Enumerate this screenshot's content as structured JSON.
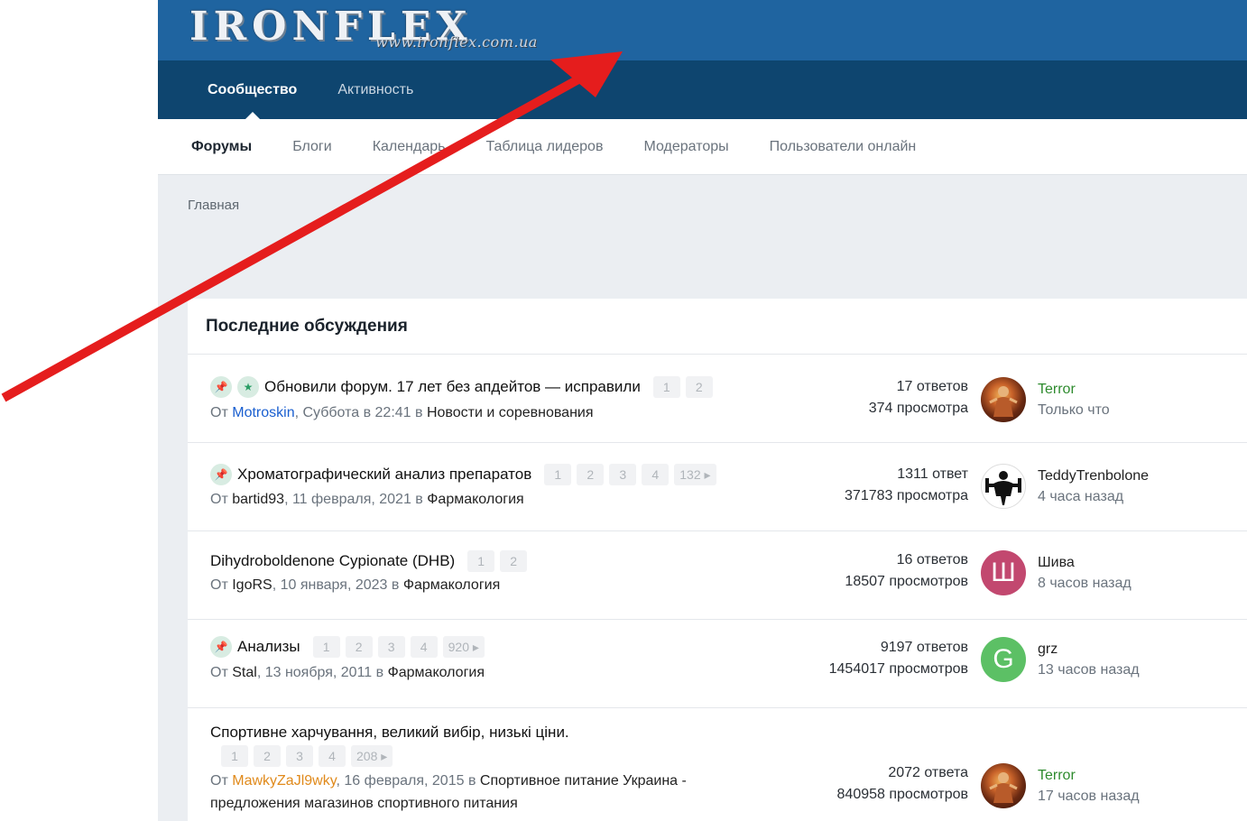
{
  "header": {
    "logo_text": "IRONFLEX",
    "logo_url": "www.ironflex.com.ua"
  },
  "primary_nav": [
    {
      "label": "Сообщество",
      "active": true
    },
    {
      "label": "Активность",
      "active": false
    }
  ],
  "secondary_nav": [
    {
      "label": "Форумы",
      "active": true
    },
    {
      "label": "Блоги",
      "active": false
    },
    {
      "label": "Календарь",
      "active": false
    },
    {
      "label": "Таблица лидеров",
      "active": false
    },
    {
      "label": "Модераторы",
      "active": false
    },
    {
      "label": "Пользователи онлайн",
      "active": false
    }
  ],
  "breadcrumb": "Главная",
  "panel_title": "Последние обсуждения",
  "topics": [
    {
      "title": "Обновили форум. 17 лет без апдейтов — исправили",
      "pinned": true,
      "featured": true,
      "pages": [
        "1",
        "2"
      ],
      "by": "От",
      "author": "Motroskin",
      "author_color": "#1a5fd0",
      "date": ", Суббота в 22:41 в ",
      "forum": "Новости и соревнования",
      "replies": "17 ответов",
      "views": "374 просмотра",
      "last_user": "Terror",
      "last_user_style": "green",
      "last_time": "Только что",
      "avatar": {
        "type": "image",
        "color": "#7a2e12",
        "letter": ""
      }
    },
    {
      "title": "Хроматографический анализ препаратов",
      "pinned": true,
      "featured": false,
      "pages": [
        "1",
        "2",
        "3",
        "4",
        "132 ▸"
      ],
      "by": "От",
      "author": "bartid93",
      "author_color": "#222222",
      "date": ", 11 февраля, 2021 в ",
      "forum": "Фармакология",
      "replies": "1311 ответ",
      "views": "371783 просмотра",
      "last_user": "TeddyTrenbolone",
      "last_user_style": "dark",
      "last_time": "4 часа назад",
      "avatar": {
        "type": "silhouette",
        "color": "#ffffff",
        "letter": ""
      }
    },
    {
      "title": "Dihydroboldenone Cypionate (DHB)",
      "pinned": false,
      "featured": false,
      "pages": [
        "1",
        "2"
      ],
      "by": "От",
      "author": "IgoRS",
      "author_color": "#222222",
      "date": ", 10 января, 2023 в ",
      "forum": "Фармакология",
      "replies": "16 ответов",
      "views": "18507 просмотров",
      "last_user": "Шива",
      "last_user_style": "dark",
      "last_time": "8 часов назад",
      "avatar": {
        "type": "letter",
        "color": "#c2486f",
        "letter": "Ш"
      }
    },
    {
      "title": "Анализы",
      "pinned": true,
      "featured": false,
      "pages": [
        "1",
        "2",
        "3",
        "4",
        "920 ▸"
      ],
      "by": "От",
      "author": "Stal",
      "author_color": "#222222",
      "date": ", 13 ноября, 2011 в ",
      "forum": "Фармакология",
      "replies": "9197 ответов",
      "views": "1454017 просмотров",
      "last_user": "grz",
      "last_user_style": "dark",
      "last_time": "13 часов назад",
      "avatar": {
        "type": "letter",
        "color": "#5cc065",
        "letter": "G"
      }
    },
    {
      "title": "Спортивне харчування, великий вибір, низькі ціни.",
      "pinned": false,
      "featured": false,
      "pages": [
        "1",
        "2",
        "3",
        "4",
        "208 ▸"
      ],
      "by": "От",
      "author": "MawkyZaJl9wky",
      "author_color": "#e08a1c",
      "date": ", 16 февраля, 2015 в ",
      "forum": "Спортивное питание Украина -",
      "forum_line2": "предложения магазинов спортивного питания",
      "replies": "2072 ответа",
      "views": "840958 просмотров",
      "last_user": "Terror",
      "last_user_style": "green",
      "last_time": "17 часов назад",
      "avatar": {
        "type": "image",
        "color": "#7a2e12",
        "letter": ""
      }
    }
  ]
}
